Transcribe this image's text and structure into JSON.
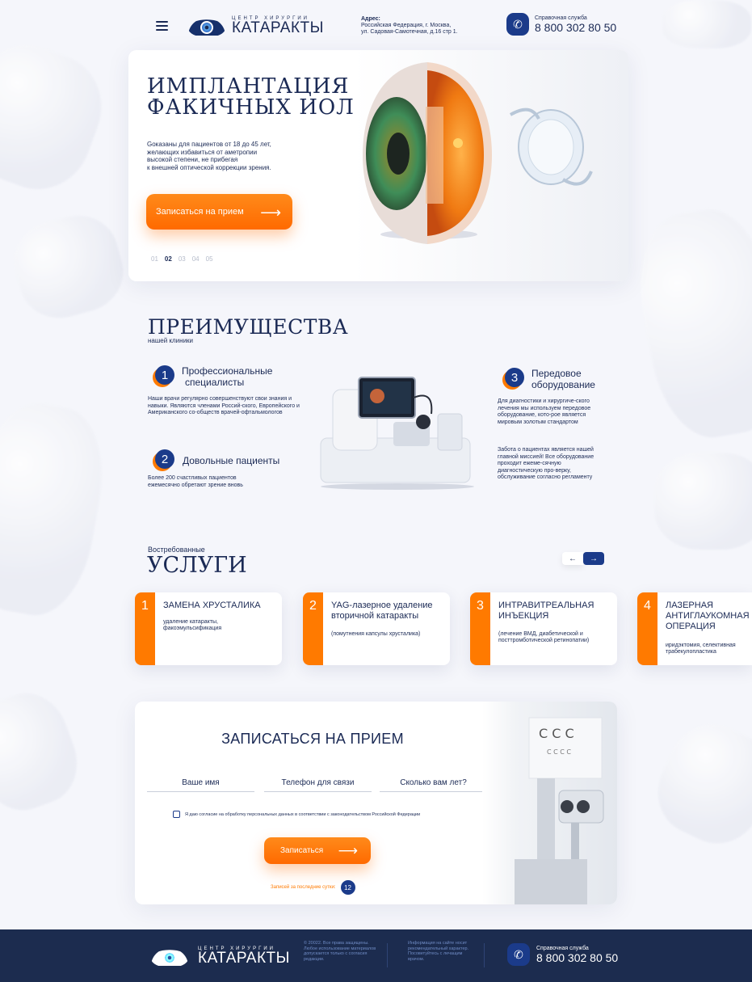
{
  "header": {
    "logo_small": "ЦЕНТР ХИРУРГИИ",
    "logo_big": "КАТАРАКТЫ",
    "address_label": "Адрес:",
    "address_line1": "Российская Федерация, г. Москва,",
    "address_line2": "ул. Садовая-Самотечная, д.16 стр 1.",
    "hotline_label": "Справочная служба",
    "hotline_phone": "8 800 302 80 50"
  },
  "hero": {
    "title_line1": "ИМПЛАНТАЦИЯ",
    "title_line2": "ФАКИЧНЫХ ИОЛ",
    "text_line1": "Gоказаны для пациентов от 18 до 45 лет,",
    "text_line2": "желающих избавиться от аметропии",
    "text_line3": "высокой степени, не прибегая",
    "text_line4": "к внешней оптической коррекции зрения.",
    "cta_label": "Записаться на прием",
    "slides": [
      "01",
      "02",
      "03",
      "04",
      "05"
    ],
    "active_slide": "02"
  },
  "advantages": {
    "title": "ПРЕИМУЩЕСТВА",
    "subtitle": "нашей клиники",
    "items": [
      {
        "num": "1",
        "head_line1": "Профессиональные",
        "head_line2": "специалисты",
        "text": "Наши врачи регулярно совершенствуют свои знания и навыки. Являются членами Россий-ского, Европейского и Американского со-обществ врачей-офтальмологов"
      },
      {
        "num": "2",
        "head_line1": "Довольные пациенты",
        "head_line2": "",
        "text": "Более 200 счастливых пациентов ежемесячно обретают зрение вновь"
      },
      {
        "num": "3",
        "head_line1": "Передовое",
        "head_line2": "оборудование",
        "text": "Для диагностики и хирургиче-ского лечения мы используем передовое оборудование, кото-рое является мировым золотым стандартом",
        "text2": "Забота о пациентах является нашей главной миссией! Все оборудование проходит ежеме-сячную диагностическую про-верку, обслуживание согласно регламенту"
      }
    ]
  },
  "services": {
    "kicker": "Востребованные",
    "title": "УСЛУГИ",
    "prev": "←",
    "next": "→",
    "cards": [
      {
        "num": "1",
        "title": "ЗАМЕНА ХРУСТАЛИКА",
        "desc": "удаление катаракты, факоэмульсификация"
      },
      {
        "num": "2",
        "title": "YAG-лазерное удаление вторичной катаракты",
        "desc": "(помутнения капсулы хрусталика)"
      },
      {
        "num": "3",
        "title": "ИНТРАВИТРЕАЛЬНАЯ ИНЪЕКЦИЯ",
        "desc": "(лечение ВМД, диабетической и посттромботической ретинопатии)"
      },
      {
        "num": "4",
        "title": "ЛАЗЕРНАЯ АНТИГЛАУКОМНАЯ ОПЕРАЦИЯ",
        "desc": "иридэктомия, селективная трабекулопластика"
      }
    ]
  },
  "form": {
    "title": "ЗАПИСАТЬСЯ НА ПРИЕМ",
    "name_placeholder": "Ваше имя",
    "phone_placeholder": "Телефон для связи",
    "age_placeholder": "Сколько вам лет?",
    "consent": "Я даю согласие на обработку персональных данных в соответствии с законодательством Российской Федерации",
    "submit_label": "Записаться",
    "counter_label": "Записей за последние сутки:",
    "counter_value": "12"
  },
  "footer": {
    "copyright": "© 20022. Все права защищены. Любое использование материалов допускается только с согласия редакции.",
    "info": "Информация на сайте носит рекомендательный характер. Посоветуйтесь с лечащим врачом.",
    "hotline_label": "Справочная служба",
    "hotline_phone": "8 800 302 80 50"
  },
  "colors": {
    "accent": "#ff7a00",
    "brand": "#1b3b8a",
    "text": "#1b2a55",
    "footer": "#1c2c4f"
  }
}
